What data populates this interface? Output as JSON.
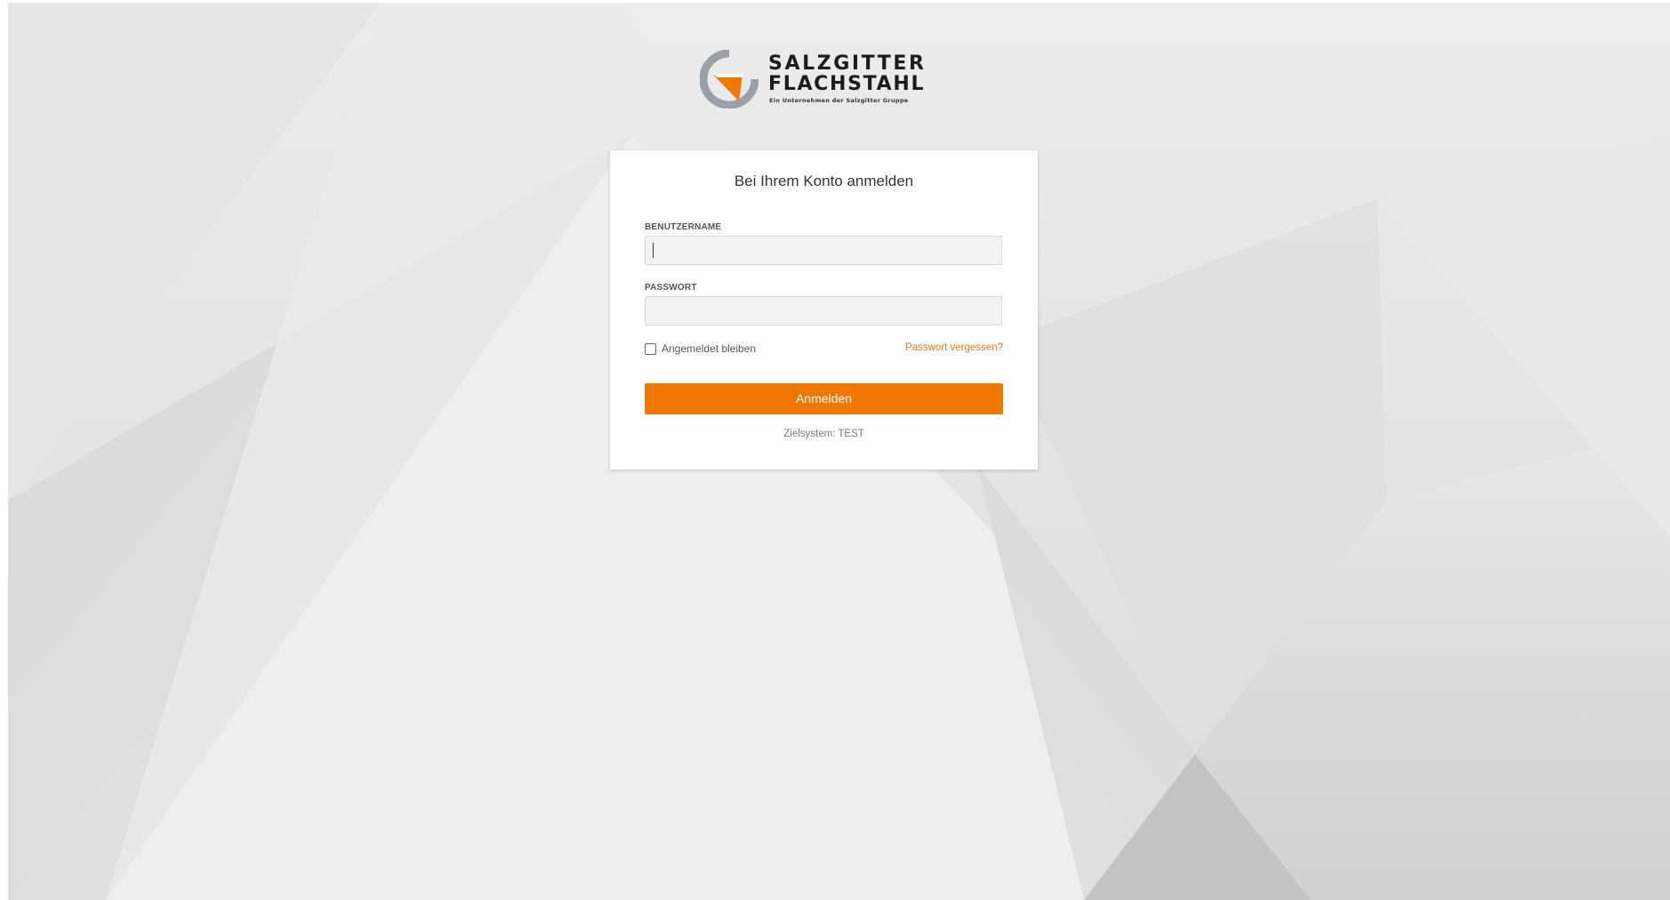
{
  "brand": {
    "line1": "SALZGITTER",
    "line2": "FLACHSTAHL",
    "tagline": "Ein Unternehmen der Salzgitter Gruppe",
    "logo_icon": "salzgitter-logo-icon",
    "accent_color": "#f07800"
  },
  "login": {
    "title": "Bei Ihrem Konto anmelden",
    "username_label": "BENUTZERNAME",
    "username_value": "",
    "password_label": "PASSWORT",
    "password_value": "",
    "remember_label": "Angemeldet bleiben",
    "remember_checked": false,
    "forgot_link": "Passwort vergessen?",
    "submit_label": "Anmelden",
    "target_system": "Zielsystem: TEST"
  }
}
